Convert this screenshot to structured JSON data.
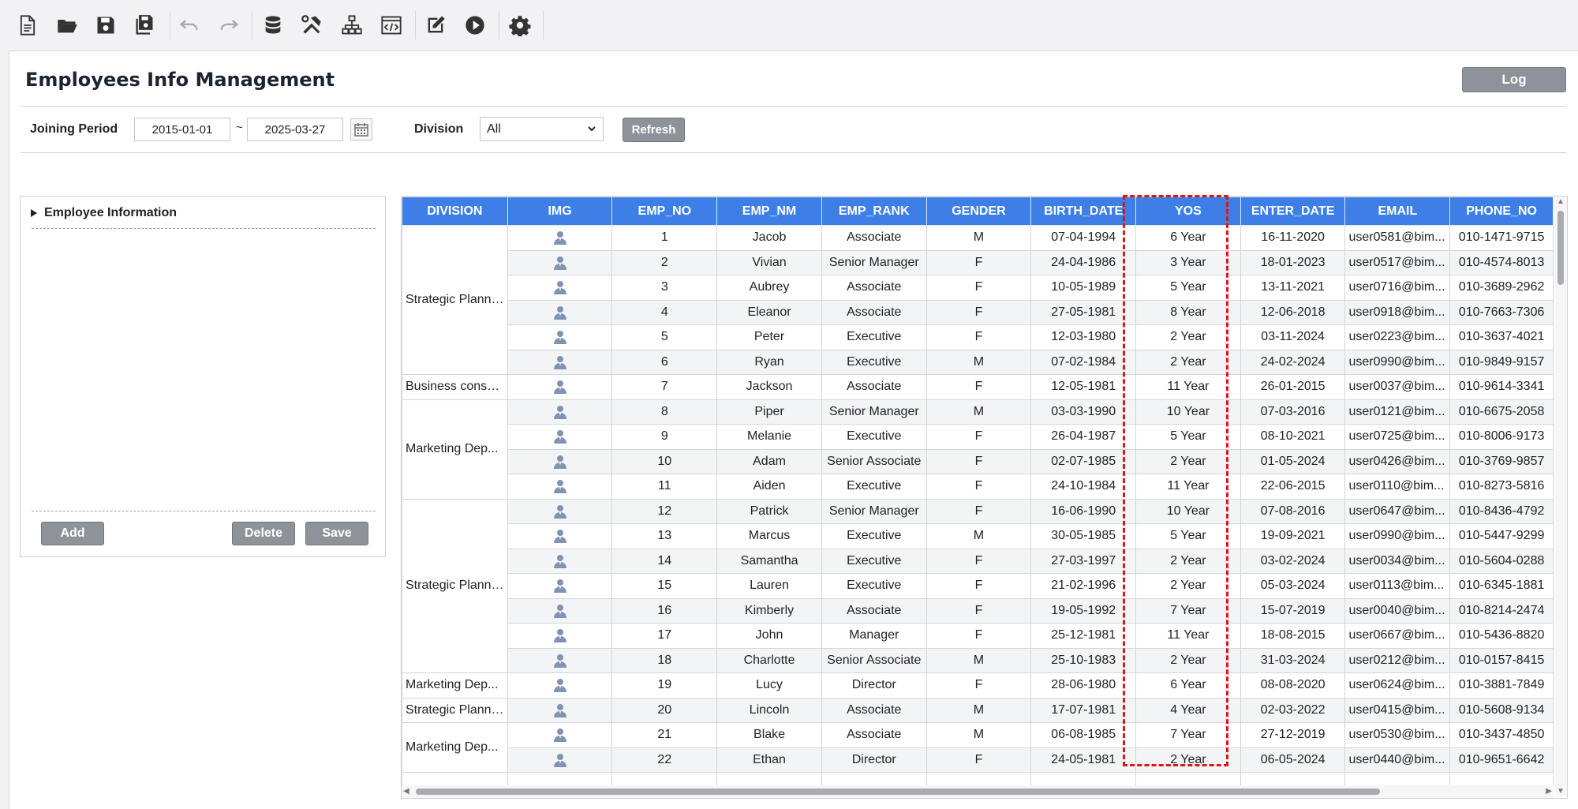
{
  "toolbar": {
    "icons": [
      "new-file-icon",
      "open-folder-icon",
      "save-icon",
      "save-all-icon",
      "undo-icon",
      "redo-icon",
      "database-icon",
      "build-tools-icon",
      "hierarchy-icon",
      "code-window-icon",
      "edit-icon",
      "run-icon",
      "settings-icon"
    ]
  },
  "header": {
    "title": "Employees Info Management",
    "log_label": "Log"
  },
  "filter": {
    "joining_period_label": "Joining Period",
    "start_date": "2015-01-01",
    "tilde": "~",
    "end_date": "2025-03-27",
    "division_label": "Division",
    "division_value": "All",
    "refresh_label": "Refresh"
  },
  "tree": {
    "header": "Employee Information",
    "add_label": "Add",
    "delete_label": "Delete",
    "save_label": "Save"
  },
  "grid": {
    "columns": [
      "DIVISION",
      "IMG",
      "EMP_NO",
      "EMP_NM",
      "EMP_RANK",
      "GENDER",
      "BIRTH_DATE",
      "YOS",
      "ENTER_DATE",
      "EMAIL",
      "PHONE_NO"
    ],
    "division_groups": [
      {
        "label": "Strategic Planni...",
        "rows": 6
      },
      {
        "label": "Business consul...",
        "rows": 1
      },
      {
        "label": "Marketing Dep...",
        "rows": 4
      },
      {
        "label": "Strategic Planni...",
        "rows": 7
      },
      {
        "label": "Marketing Dep...",
        "rows": 1
      },
      {
        "label": "Strategic Planni...",
        "rows": 1
      },
      {
        "label": "Marketing Dep...",
        "rows": 2
      }
    ],
    "rows": [
      {
        "no": "1",
        "name": "Jacob",
        "rank": "Associate",
        "gender": "M",
        "birth": "07-04-1994",
        "yos": "6 Year",
        "enter": "16-11-2020",
        "email": "user0581@bim...",
        "phone": "010-1471-9715"
      },
      {
        "no": "2",
        "name": "Vivian",
        "rank": "Senior Manager",
        "gender": "F",
        "birth": "24-04-1986",
        "yos": "3 Year",
        "enter": "18-01-2023",
        "email": "user0517@bim...",
        "phone": "010-4574-8013"
      },
      {
        "no": "3",
        "name": "Aubrey",
        "rank": "Associate",
        "gender": "F",
        "birth": "10-05-1989",
        "yos": "5 Year",
        "enter": "13-11-2021",
        "email": "user0716@bim...",
        "phone": "010-3689-2962"
      },
      {
        "no": "4",
        "name": "Eleanor",
        "rank": "Associate",
        "gender": "F",
        "birth": "27-05-1981",
        "yos": "8 Year",
        "enter": "12-06-2018",
        "email": "user0918@bim...",
        "phone": "010-7663-7306"
      },
      {
        "no": "5",
        "name": "Peter",
        "rank": "Executive",
        "gender": "F",
        "birth": "12-03-1980",
        "yos": "2 Year",
        "enter": "03-11-2024",
        "email": "user0223@bim...",
        "phone": "010-3637-4021"
      },
      {
        "no": "6",
        "name": "Ryan",
        "rank": "Executive",
        "gender": "M",
        "birth": "07-02-1984",
        "yos": "2 Year",
        "enter": "24-02-2024",
        "email": "user0990@bim...",
        "phone": "010-9849-9157"
      },
      {
        "no": "7",
        "name": "Jackson",
        "rank": "Associate",
        "gender": "F",
        "birth": "12-05-1981",
        "yos": "11 Year",
        "enter": "26-01-2015",
        "email": "user0037@bim...",
        "phone": "010-9614-3341"
      },
      {
        "no": "8",
        "name": "Piper",
        "rank": "Senior Manager",
        "gender": "M",
        "birth": "03-03-1990",
        "yos": "10 Year",
        "enter": "07-03-2016",
        "email": "user0121@bim...",
        "phone": "010-6675-2058"
      },
      {
        "no": "9",
        "name": "Melanie",
        "rank": "Executive",
        "gender": "F",
        "birth": "26-04-1987",
        "yos": "5 Year",
        "enter": "08-10-2021",
        "email": "user0725@bim...",
        "phone": "010-8006-9173"
      },
      {
        "no": "10",
        "name": "Adam",
        "rank": "Senior Associate",
        "gender": "F",
        "birth": "02-07-1985",
        "yos": "2 Year",
        "enter": "01-05-2024",
        "email": "user0426@bim...",
        "phone": "010-3769-9857"
      },
      {
        "no": "11",
        "name": "Aiden",
        "rank": "Executive",
        "gender": "F",
        "birth": "24-10-1984",
        "yos": "11 Year",
        "enter": "22-06-2015",
        "email": "user0110@bim...",
        "phone": "010-8273-5816"
      },
      {
        "no": "12",
        "name": "Patrick",
        "rank": "Senior Manager",
        "gender": "F",
        "birth": "16-06-1990",
        "yos": "10 Year",
        "enter": "07-08-2016",
        "email": "user0647@bim...",
        "phone": "010-8436-4792"
      },
      {
        "no": "13",
        "name": "Marcus",
        "rank": "Executive",
        "gender": "M",
        "birth": "30-05-1985",
        "yos": "5 Year",
        "enter": "19-09-2021",
        "email": "user0990@bim...",
        "phone": "010-5447-9299"
      },
      {
        "no": "14",
        "name": "Samantha",
        "rank": "Executive",
        "gender": "F",
        "birth": "27-03-1997",
        "yos": "2 Year",
        "enter": "03-02-2024",
        "email": "user0034@bim...",
        "phone": "010-5604-0288"
      },
      {
        "no": "15",
        "name": "Lauren",
        "rank": "Executive",
        "gender": "F",
        "birth": "21-02-1996",
        "yos": "2 Year",
        "enter": "05-03-2024",
        "email": "user0113@bim...",
        "phone": "010-6345-1881"
      },
      {
        "no": "16",
        "name": "Kimberly",
        "rank": "Associate",
        "gender": "F",
        "birth": "19-05-1992",
        "yos": "7 Year",
        "enter": "15-07-2019",
        "email": "user0040@bim...",
        "phone": "010-8214-2474"
      },
      {
        "no": "17",
        "name": "John",
        "rank": "Manager",
        "gender": "F",
        "birth": "25-12-1981",
        "yos": "11 Year",
        "enter": "18-08-2015",
        "email": "user0667@bim...",
        "phone": "010-5436-8820"
      },
      {
        "no": "18",
        "name": "Charlotte",
        "rank": "Senior Associate",
        "gender": "M",
        "birth": "25-10-1983",
        "yos": "2 Year",
        "enter": "31-03-2024",
        "email": "user0212@bim...",
        "phone": "010-0157-8415"
      },
      {
        "no": "19",
        "name": "Lucy",
        "rank": "Director",
        "gender": "F",
        "birth": "28-06-1980",
        "yos": "6 Year",
        "enter": "08-08-2020",
        "email": "user0624@bim...",
        "phone": "010-3881-7849"
      },
      {
        "no": "20",
        "name": "Lincoln",
        "rank": "Associate",
        "gender": "M",
        "birth": "17-07-1981",
        "yos": "4 Year",
        "enter": "02-03-2022",
        "email": "user0415@bim...",
        "phone": "010-5608-9134"
      },
      {
        "no": "21",
        "name": "Blake",
        "rank": "Associate",
        "gender": "M",
        "birth": "06-08-1985",
        "yos": "7 Year",
        "enter": "27-12-2019",
        "email": "user0530@bim...",
        "phone": "010-3437-4850"
      },
      {
        "no": "22",
        "name": "Ethan",
        "rank": "Director",
        "gender": "F",
        "birth": "24-05-1981",
        "yos": "2 Year",
        "enter": "06-05-2024",
        "email": "user0440@bim...",
        "phone": "010-9651-6642"
      }
    ]
  },
  "colors": {
    "header_blue": "#3d7fe6",
    "highlight_red": "#e01515",
    "button_grey": "#8e939a"
  }
}
